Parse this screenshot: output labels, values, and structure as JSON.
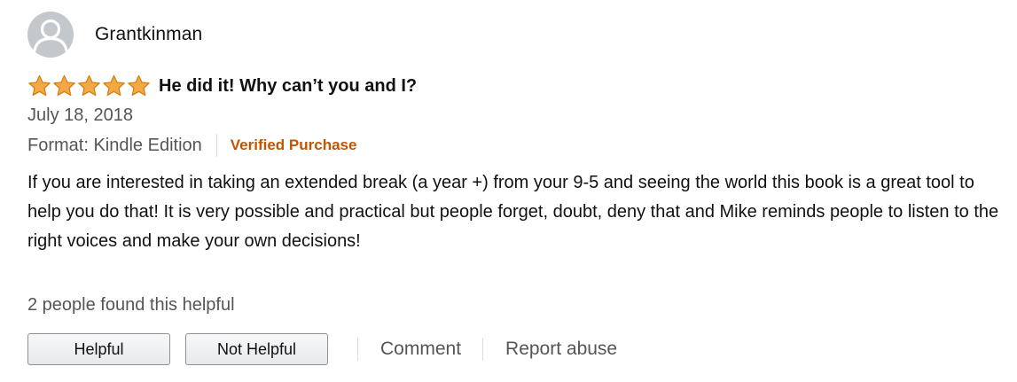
{
  "reviewer": {
    "name": "Grantkinman",
    "avatar_icon": "user-silhouette-icon"
  },
  "review": {
    "rating": 5,
    "rating_max": 5,
    "star_color": "#f3a847",
    "title": "He did it! Why can’t you and I?",
    "date": "July 18, 2018",
    "format": "Format: Kindle Edition",
    "verified": "Verified Purchase",
    "verified_color": "#c45500",
    "body": "If you are interested in taking an extended break (a year +) from your 9-5 and seeing the world this book is a great tool to help you do that! It is very possible and practical but people forget, doubt, deny that and Mike reminds people to listen to the right voices and make your own decisions!"
  },
  "feedback": {
    "helpful_count_text": "2 people found this helpful",
    "helpful_label": "Helpful",
    "not_helpful_label": "Not Helpful",
    "comment_label": "Comment",
    "report_label": "Report abuse"
  }
}
